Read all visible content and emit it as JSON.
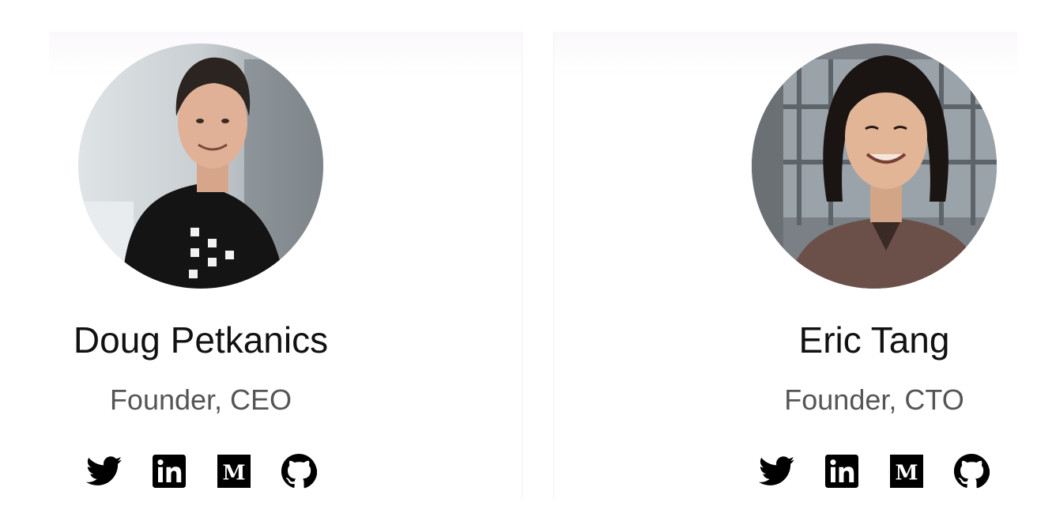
{
  "team": [
    {
      "name": "Doug Petkanics",
      "role": "Founder, CEO",
      "socials": [
        "twitter-icon",
        "linkedin-icon",
        "medium-icon",
        "github-icon"
      ]
    },
    {
      "name": "Eric Tang",
      "role": "Founder, CTO",
      "socials": [
        "twitter-icon",
        "linkedin-icon",
        "medium-icon",
        "github-icon"
      ]
    }
  ],
  "icons": {
    "medium_glyph": "M"
  },
  "colors": {
    "text": "#111111",
    "role_text": "#555555",
    "icon": "#000000"
  }
}
